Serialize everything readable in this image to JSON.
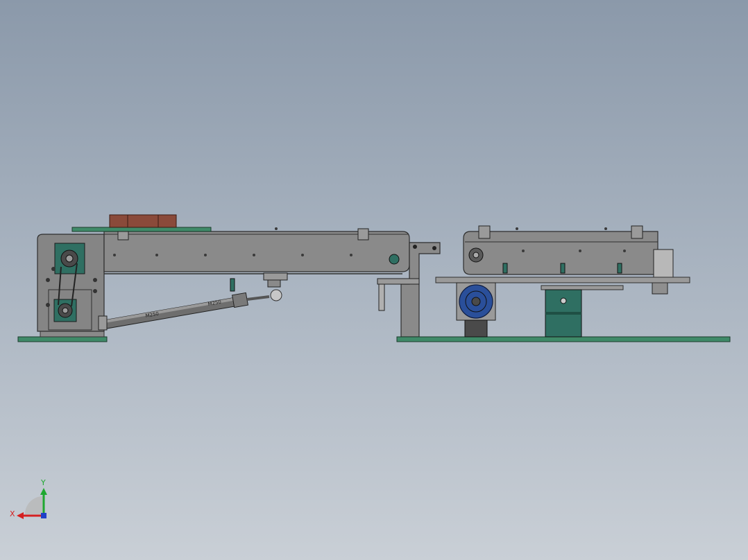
{
  "viewport": {
    "background_top": "#8b99aa",
    "background_bottom": "#c9cfd6"
  },
  "colors": {
    "frame": "#7f7f7f",
    "frame_dark": "#3a3a3a",
    "teal_part": "#2f6f62",
    "green_plate": "#3f8a68",
    "brown_block": "#8a4a3a",
    "motor_blue": "#2a4f9a",
    "cylinder": "#6e6e6e"
  },
  "cylinder_marking_left": "M250",
  "cylinder_marking_right": "M250",
  "triad": {
    "x_label": "X",
    "y_label": "Y",
    "x_color": "#d42020",
    "y_color": "#1fa830",
    "z_color": "#2040c8"
  }
}
